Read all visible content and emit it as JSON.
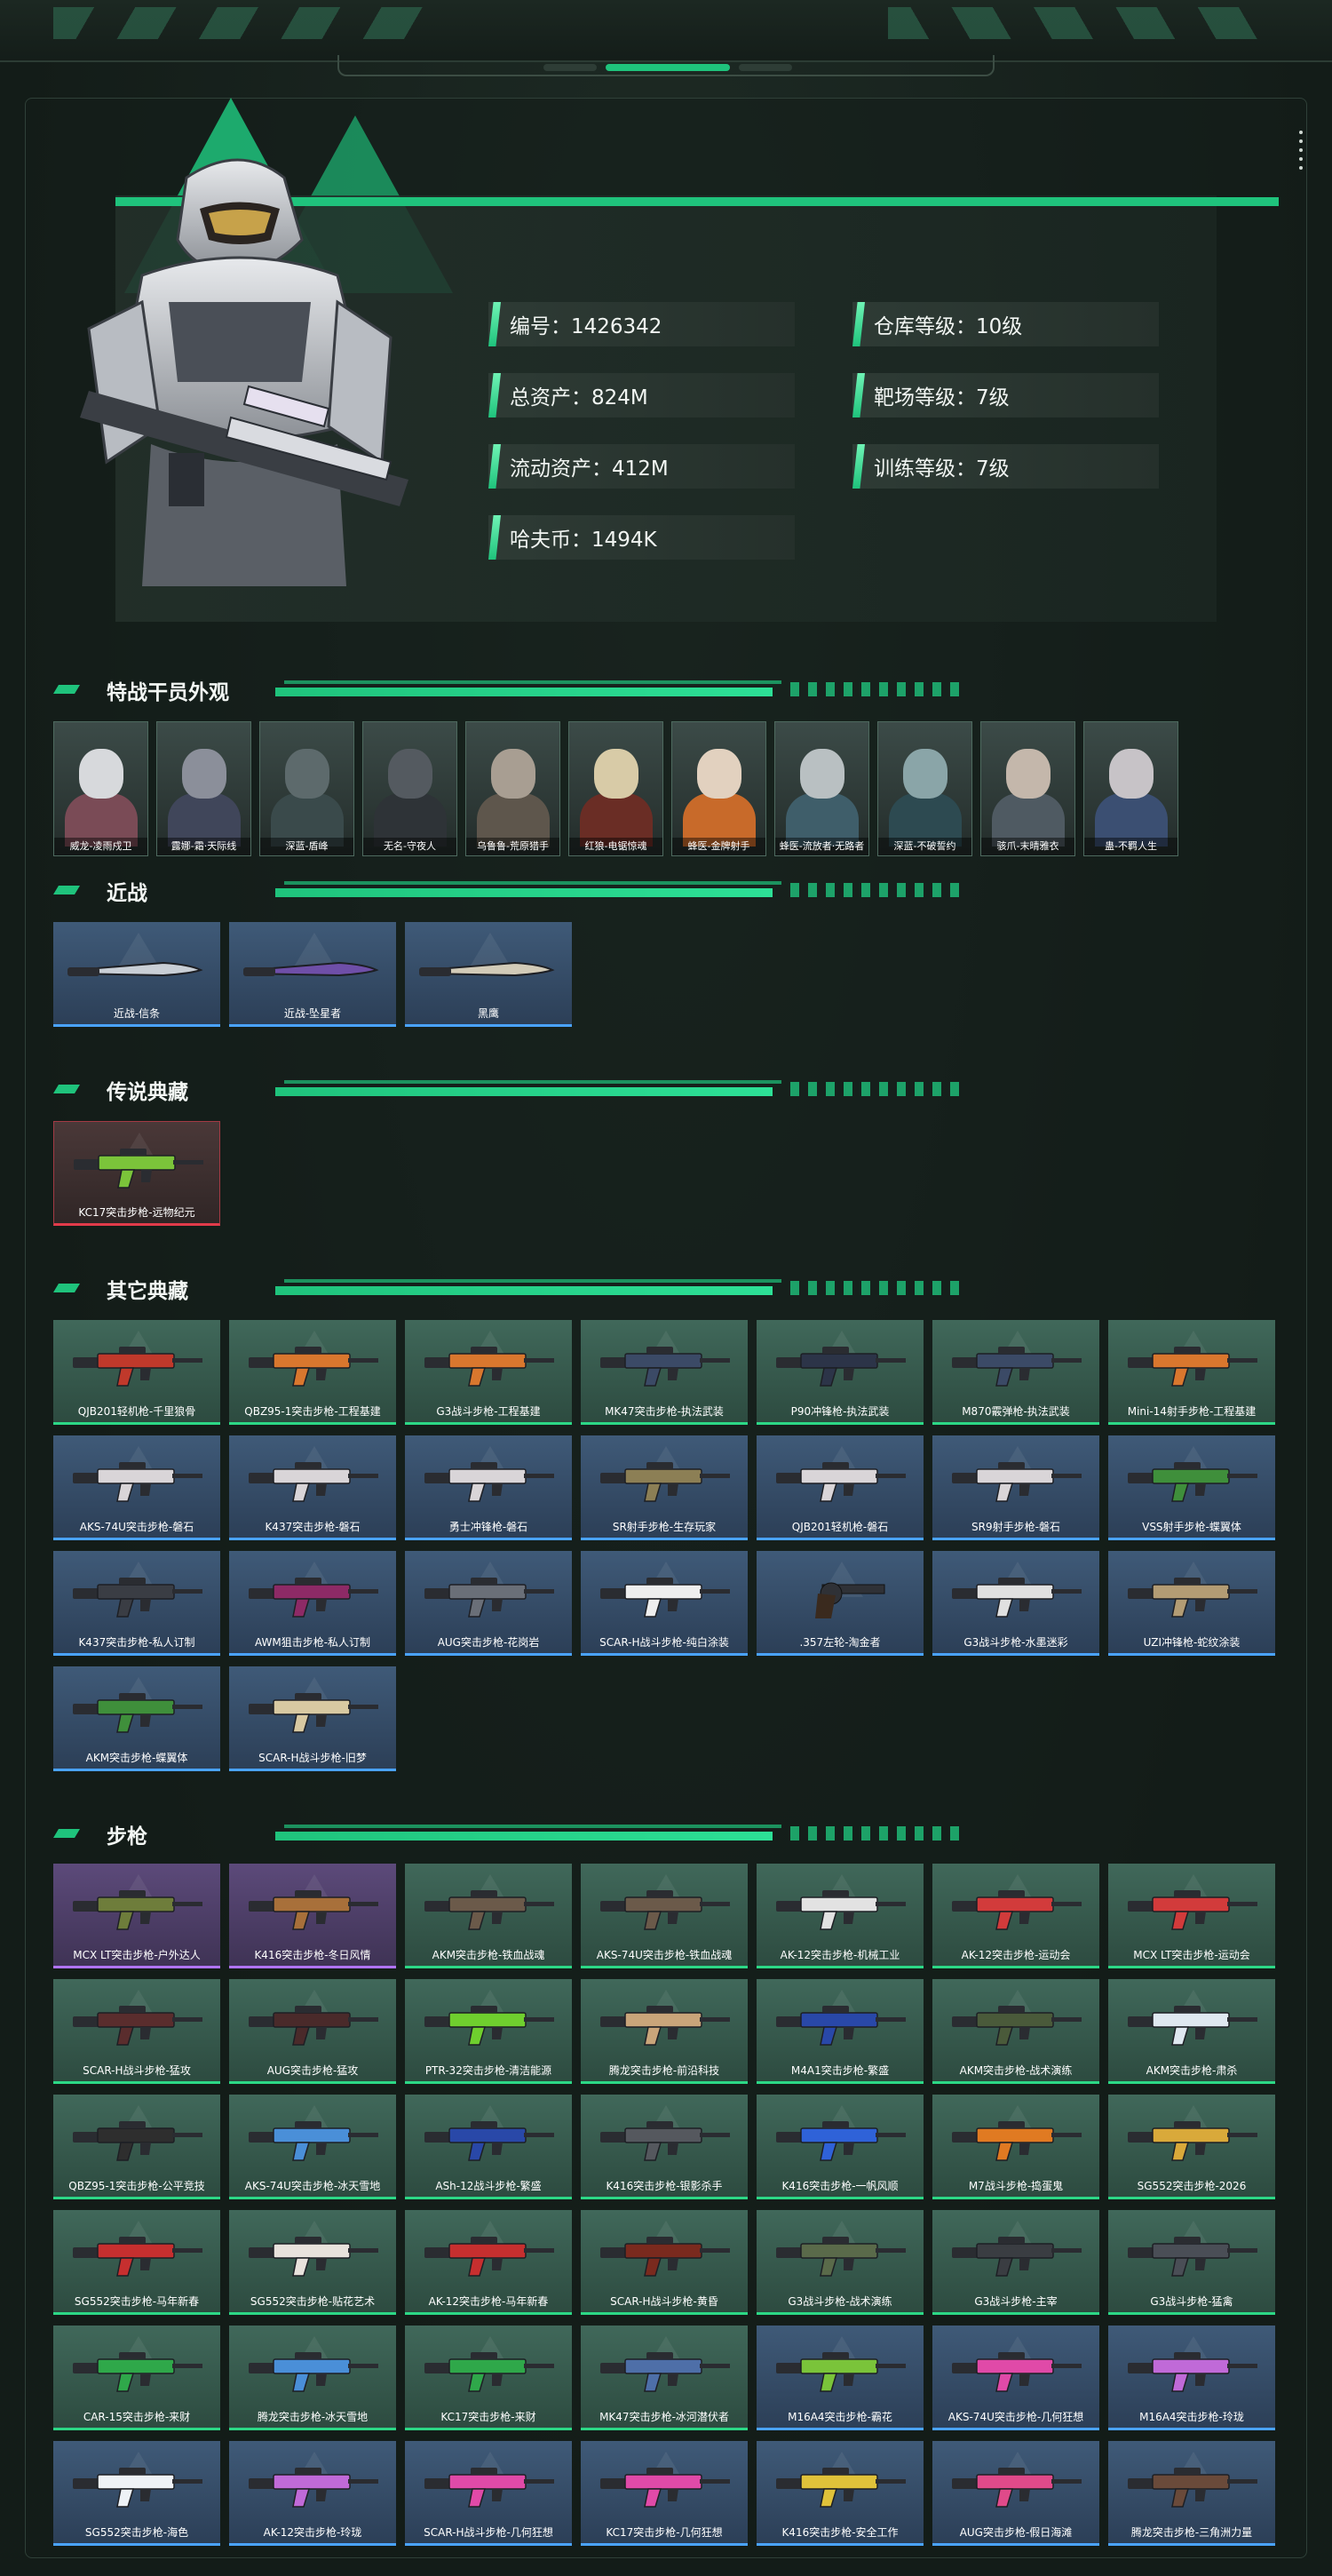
{
  "profile": {
    "id": "编号：1426342",
    "total_assets": "总资产：824M",
    "liquid_assets": "流动资产：412M",
    "havoc_coin": "哈夫币：1494K",
    "warehouse_level": "仓库等级：10级",
    "range_level": "靶场等级：7级",
    "training_level": "训练等级：7级"
  },
  "sections": {
    "operators": "特战干员外观",
    "melee": "近战",
    "legendary": "传说典藏",
    "other": "其它典藏",
    "rifles": "步枪"
  },
  "operators": [
    {
      "label": "威龙-凌雨戍卫",
      "skin": "#d7d9dc",
      "accent": "#7a4b56"
    },
    {
      "label": "露娜-霜·天际线",
      "skin": "#8b8f9a",
      "accent": "#40465a"
    },
    {
      "label": "深蓝-盾峰",
      "skin": "#5d6a6c",
      "accent": "#3a4a4b"
    },
    {
      "label": "无名-守夜人",
      "skin": "#545a60",
      "accent": "#2e3337"
    },
    {
      "label": "乌鲁鲁-荒原猎手",
      "skin": "#a89e92",
      "accent": "#5e564c"
    },
    {
      "label": "红狼-电锯惊魂",
      "skin": "#d8cba7",
      "accent": "#6a2d25"
    },
    {
      "label": "蜂医-金牌射手",
      "skin": "#e2d1bf",
      "accent": "#c86a2a"
    },
    {
      "label": "蜂医-流放者·无路者",
      "skin": "#b9c0c2",
      "accent": "#3f5e6a"
    },
    {
      "label": "深蓝-不破誓约",
      "skin": "#8aa5a8",
      "accent": "#2d4a51"
    },
    {
      "label": "骇爪-末晴雅衣",
      "skin": "#c4b7ab",
      "accent": "#4f5a62"
    },
    {
      "label": "蛊-不羁人生",
      "skin": "#c7c3c7",
      "accent": "#3b4f72"
    }
  ],
  "melee": [
    {
      "label": "近战-信条",
      "tier": "blue",
      "color": "#c9cfd6",
      "icon": "knife-icon"
    },
    {
      "label": "近战-坠星者",
      "tier": "blue",
      "color": "#6f4fa8",
      "icon": "knife-icon"
    },
    {
      "label": "黑鹰",
      "tier": "blue",
      "color": "#d2cbb8",
      "icon": "knife-icon"
    }
  ],
  "legendary": [
    {
      "label": "KC17突击步枪-远物纪元",
      "tier": "red",
      "color": "#7bc43a",
      "icon": "rifle-icon"
    }
  ],
  "other": [
    {
      "label": "QJB201轻机枪-千里狼骨",
      "tier": "green",
      "color": "#c0392b",
      "icon": "rifle-icon"
    },
    {
      "label": "QBZ95-1突击步枪-工程基建",
      "tier": "green",
      "color": "#d9772e",
      "icon": "rifle-icon"
    },
    {
      "label": "G3战斗步枪-工程基建",
      "tier": "green",
      "color": "#d9772e",
      "icon": "rifle-icon"
    },
    {
      "label": "MK47突击步枪-执法武装",
      "tier": "green",
      "color": "#3b4a66",
      "icon": "rifle-icon"
    },
    {
      "label": "P90冲锋枪-执法武装",
      "tier": "green",
      "color": "#2c3448",
      "icon": "rifle-icon"
    },
    {
      "label": "M870霰弹枪-执法武装",
      "tier": "green",
      "color": "#3b4a66",
      "icon": "rifle-icon"
    },
    {
      "label": "Mini-14射手步枪-工程基建",
      "tier": "green",
      "color": "#d9772e",
      "icon": "rifle-icon"
    },
    {
      "label": "AKS-74U突击步枪-磐石",
      "tier": "blue",
      "color": "#d9d5d8",
      "icon": "rifle-icon"
    },
    {
      "label": "K437突击步枪-磐石",
      "tier": "blue",
      "color": "#d9d5d8",
      "icon": "rifle-icon"
    },
    {
      "label": "勇士冲锋枪-磐石",
      "tier": "blue",
      "color": "#d9d5d8",
      "icon": "rifle-icon"
    },
    {
      "label": "SR射手步枪-生存玩家",
      "tier": "blue",
      "color": "#8c7f55",
      "icon": "rifle-icon"
    },
    {
      "label": "QJB201轻机枪-磐石",
      "tier": "blue",
      "color": "#d9d5d8",
      "icon": "rifle-icon"
    },
    {
      "label": "SR9射手步枪-磐石",
      "tier": "blue",
      "color": "#d9d5d8",
      "icon": "rifle-icon"
    },
    {
      "label": "VSS射手步枪-蝶翼体",
      "tier": "blue",
      "color": "#3f8f3b",
      "icon": "rifle-icon"
    },
    {
      "label": "K437突击步枪-私人订制",
      "tier": "blue",
      "color": "#3a3d44",
      "icon": "rifle-icon"
    },
    {
      "label": "AWM狙击步枪-私人订制",
      "tier": "blue",
      "color": "#8d2a66",
      "icon": "rifle-icon"
    },
    {
      "label": "AUG突击步枪-花岗岩",
      "tier": "blue",
      "color": "#6a6f78",
      "icon": "rifle-icon"
    },
    {
      "label": "SCAR-H战斗步枪-纯白涂装",
      "tier": "blue",
      "color": "#eeeeee",
      "icon": "rifle-icon"
    },
    {
      "label": ".357左轮-淘金者",
      "tier": "blue",
      "color": "#2f3136",
      "icon": "revolver-icon"
    },
    {
      "label": "G3战斗步枪-水墨迷彩",
      "tier": "blue",
      "color": "#e0e0e0",
      "icon": "rifle-icon"
    },
    {
      "label": "UZI冲锋枪-蛇纹涂装",
      "tier": "blue",
      "color": "#b39c74",
      "icon": "rifle-icon"
    },
    {
      "label": "AKM突击步枪-蝶翼体",
      "tier": "blue",
      "color": "#3f8f3b",
      "icon": "rifle-icon"
    },
    {
      "label": "SCAR-H战斗步枪-旧梦",
      "tier": "blue",
      "color": "#d8c9a2",
      "icon": "rifle-icon"
    }
  ],
  "rifles": [
    {
      "label": "MCX LT突击步枪-户外达人",
      "tier": "purple",
      "color": "#6e7d3b",
      "icon": "rifle-icon"
    },
    {
      "label": "K416突击步枪-冬日风情",
      "tier": "purple",
      "color": "#a8703a",
      "icon": "rifle-icon"
    },
    {
      "label": "AKM突击步枪-铁血战魂",
      "tier": "green",
      "color": "#6b5a4a",
      "icon": "rifle-icon"
    },
    {
      "label": "AKS-74U突击步枪-铁血战魂",
      "tier": "green",
      "color": "#6b5a4a",
      "icon": "rifle-icon"
    },
    {
      "label": "AK-12突击步枪-机械工业",
      "tier": "green",
      "color": "#e2e2e2",
      "icon": "rifle-icon"
    },
    {
      "label": "AK-12突击步枪-运动会",
      "tier": "green",
      "color": "#d23b3b",
      "icon": "rifle-icon"
    },
    {
      "label": "MCX LT突击步枪-运动会",
      "tier": "green",
      "color": "#d23b3b",
      "icon": "rifle-icon"
    },
    {
      "label": "SCAR-H战斗步枪-猛攻",
      "tier": "green",
      "color": "#5a2d2d",
      "icon": "rifle-icon"
    },
    {
      "label": "AUG突击步枪-猛攻",
      "tier": "green",
      "color": "#4a2a2a",
      "icon": "rifle-icon"
    },
    {
      "label": "PTR-32突击步枪-清洁能源",
      "tier": "green",
      "color": "#6fcf2e",
      "icon": "rifle-icon"
    },
    {
      "label": "腾龙突击步枪-前沿科技",
      "tier": "green",
      "color": "#c9a57a",
      "icon": "rifle-icon"
    },
    {
      "label": "M4A1突击步枪-繁盛",
      "tier": "green",
      "color": "#2948a8",
      "icon": "rifle-icon"
    },
    {
      "label": "AKM突击步枪-战术演练",
      "tier": "green",
      "color": "#4a5a3a",
      "icon": "rifle-icon"
    },
    {
      "label": "AKM突击步枪-肃杀",
      "tier": "green",
      "color": "#dfe8f0",
      "icon": "rifle-icon"
    },
    {
      "label": "QBZ95-1突击步枪-公平竞技",
      "tier": "green",
      "color": "#2e2e2e",
      "icon": "rifle-icon"
    },
    {
      "label": "AKS-74U突击步枪-冰天雪地",
      "tier": "green",
      "color": "#4a8fd8",
      "icon": "rifle-icon"
    },
    {
      "label": "ASh-12战斗步枪-繁盛",
      "tier": "green",
      "color": "#2948a8",
      "icon": "rifle-icon"
    },
    {
      "label": "K416突击步枪-银影杀手",
      "tier": "green",
      "color": "#55585e",
      "icon": "rifle-icon"
    },
    {
      "label": "K416突击步枪-一帆风顺",
      "tier": "green",
      "color": "#2f62d8",
      "icon": "rifle-icon"
    },
    {
      "label": "M7战斗步枪-捣蛋鬼",
      "tier": "green",
      "color": "#e07a22",
      "icon": "rifle-icon"
    },
    {
      "label": "SG552突击步枪-2026",
      "tier": "green",
      "color": "#d9a93a",
      "icon": "rifle-icon"
    },
    {
      "label": "SG552突击步枪-马年新春",
      "tier": "green",
      "color": "#c62f2f",
      "icon": "rifle-icon"
    },
    {
      "label": "SG552突击步枪-贴花艺术",
      "tier": "green",
      "color": "#e8e2dc",
      "icon": "rifle-icon"
    },
    {
      "label": "AK-12突击步枪-马年新春",
      "tier": "green",
      "color": "#c62f2f",
      "icon": "rifle-icon"
    },
    {
      "label": "SCAR-H战斗步枪-黄昏",
      "tier": "green",
      "color": "#7a2a1e",
      "icon": "rifle-icon"
    },
    {
      "label": "G3战斗步枪-战术演练",
      "tier": "green",
      "color": "#5a6a4a",
      "icon": "rifle-icon"
    },
    {
      "label": "G3战斗步枪-主宰",
      "tier": "green",
      "color": "#3a3d42",
      "icon": "rifle-icon"
    },
    {
      "label": "G3战斗步枪-猛禽",
      "tier": "green",
      "color": "#4a4e56",
      "icon": "rifle-icon"
    },
    {
      "label": "CAR-15突击步枪-来财",
      "tier": "green",
      "color": "#2fa84a",
      "icon": "rifle-icon"
    },
    {
      "label": "腾龙突击步枪-冰天雪地",
      "tier": "green",
      "color": "#4a8fd8",
      "icon": "rifle-icon"
    },
    {
      "label": "KC17突击步枪-来财",
      "tier": "green",
      "color": "#2fa84a",
      "icon": "rifle-icon"
    },
    {
      "label": "MK47突击步枪-冰河潜伏者",
      "tier": "green",
      "color": "#4e6fa8",
      "icon": "rifle-icon"
    },
    {
      "label": "M16A4突击步枪-霸花",
      "tier": "blue",
      "color": "#7ac43a",
      "icon": "rifle-icon"
    },
    {
      "label": "AKS-74U突击步枪-几何狂想",
      "tier": "blue",
      "color": "#e04aa8",
      "icon": "rifle-icon"
    },
    {
      "label": "M16A4突击步枪-玲珑",
      "tier": "blue",
      "color": "#c06ad8",
      "icon": "rifle-icon"
    },
    {
      "label": "SG552突击步枪-海色",
      "tier": "blue",
      "color": "#eef2f6",
      "icon": "rifle-icon"
    },
    {
      "label": "AK-12突击步枪-玲珑",
      "tier": "blue",
      "color": "#c06ad8",
      "icon": "rifle-icon"
    },
    {
      "label": "SCAR-H战斗步枪-几何狂想",
      "tier": "blue",
      "color": "#e04aa8",
      "icon": "rifle-icon"
    },
    {
      "label": "KC17突击步枪-几何狂想",
      "tier": "blue",
      "color": "#e04aa8",
      "icon": "rifle-icon"
    },
    {
      "label": "K416突击步枪-安全工作",
      "tier": "blue",
      "color": "#e0c23a",
      "icon": "rifle-icon"
    },
    {
      "label": "AUG突击步枪-假日海滩",
      "tier": "blue",
      "color": "#e04a8a",
      "icon": "rifle-icon"
    },
    {
      "label": "腾龙突击步枪-三角洲力量",
      "tier": "blue",
      "color": "#6a4a3a",
      "icon": "rifle-icon"
    }
  ]
}
